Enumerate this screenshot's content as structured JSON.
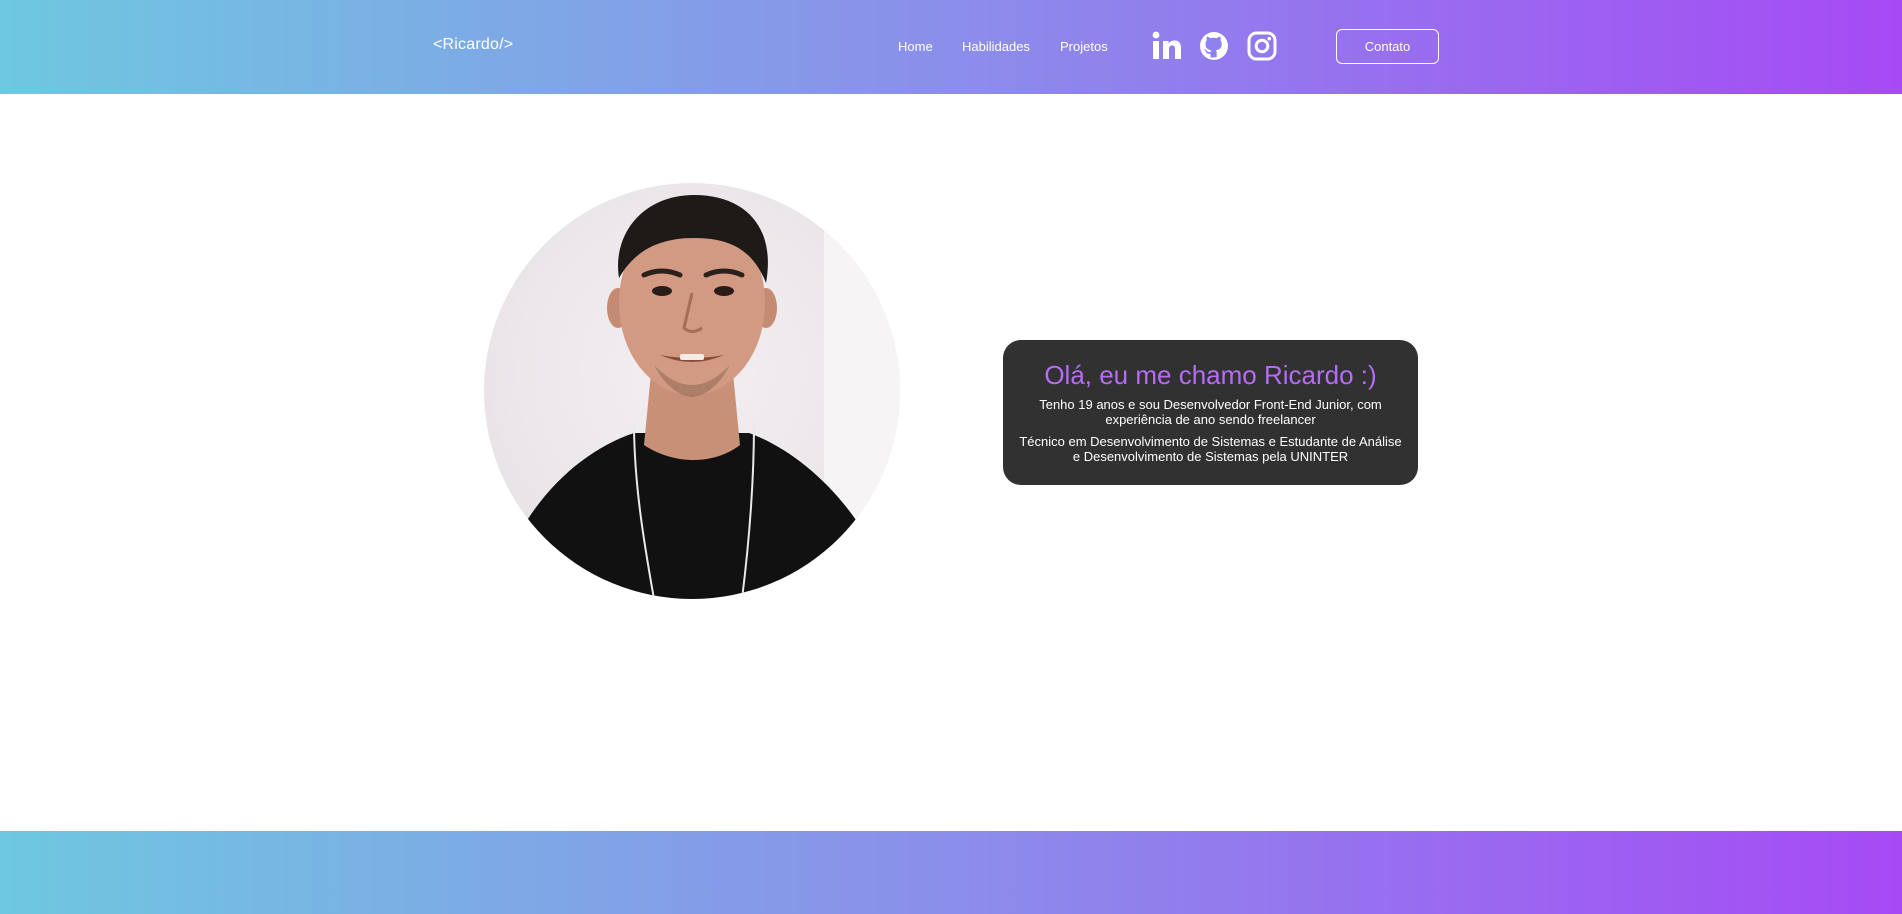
{
  "header": {
    "logo": "<Ricardo/>",
    "nav": [
      {
        "label": "Home"
      },
      {
        "label": "Habilidades"
      },
      {
        "label": "Projetos"
      }
    ],
    "social_icons": [
      "linkedin-icon",
      "github-icon",
      "instagram-icon"
    ],
    "contact_label": "Contato"
  },
  "intro": {
    "title": "Olá, eu me chamo Ricardo :)",
    "paragraph_1": "Tenho 19 anos e sou Desenvolvedor Front-End Junior, com experiência de ano sendo freelancer",
    "paragraph_2": "Técnico em Desenvolvimento de Sistemas e Estudante de Análise e Desenvolvimento de Sistemas pela UNINTER"
  },
  "colors": {
    "gradient_start": "#6ec8e0",
    "gradient_end": "#a64af5",
    "card_bg": "#313131",
    "title_accent": "#b56cf7"
  }
}
